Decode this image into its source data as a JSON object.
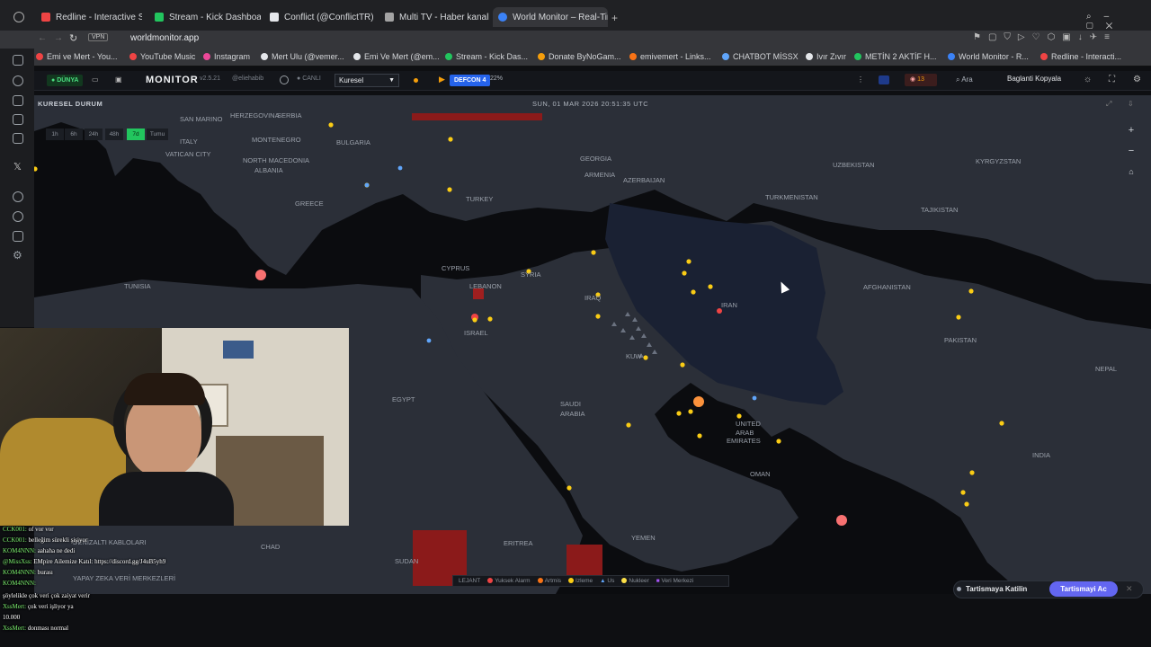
{
  "browser": {
    "tabs": [
      {
        "label": "Redline - Interactive Strate",
        "color": "#ef4444"
      },
      {
        "label": "Stream - Kick Dashboard",
        "color": "#22c55e"
      },
      {
        "label": "Conflict (@ConflictTR) / X",
        "color": "#e5e7eb"
      },
      {
        "label": "Multi TV - Haber kanallar",
        "color": "#a3a3a3"
      },
      {
        "label": "World Monitor – Real-Time",
        "color": "#3b82f6"
      }
    ],
    "vpn_label": "VPN",
    "url": "worldmonitor.app",
    "bookmarks": [
      {
        "label": "Emi ve Mert - You...",
        "color": "#ef4444"
      },
      {
        "label": "YouTube Music",
        "color": "#ef4444"
      },
      {
        "label": "Instagram",
        "color": "#ec4899"
      },
      {
        "label": "Mert Ulu (@vemer...",
        "color": "#e5e7eb"
      },
      {
        "label": "Emi Ve Mert (@em...",
        "color": "#e5e7eb"
      },
      {
        "label": "Stream - Kick Das...",
        "color": "#22c55e"
      },
      {
        "label": "Donate ByNoGam...",
        "color": "#f59e0b"
      },
      {
        "label": "emivemert - Links...",
        "color": "#f97316"
      },
      {
        "label": "CHATBOT MİSSX",
        "color": "#60a5fa"
      },
      {
        "label": "Ivır Zıvır",
        "color": "#e5e7eb"
      },
      {
        "label": "METİN 2 AKTİF H...",
        "color": "#22c55e"
      },
      {
        "label": "World Monitor - R...",
        "color": "#3b82f6"
      },
      {
        "label": "Redline - Interacti...",
        "color": "#ef4444"
      }
    ]
  },
  "app": {
    "live_label": "DÜNYA",
    "title": "MONITOR",
    "version": "v2.5.21",
    "handle": "@eliehabib",
    "live_status": "CANLI",
    "region": "Kuresel",
    "defcon": "DEFCON 4",
    "defcon_pct": "22%",
    "alert_count": "13",
    "search_label": "Ara",
    "copy_link_label": "Baglanti Kopyala"
  },
  "map": {
    "panel_title": "KURESEL DURUM",
    "datetime": "SUN, 01 MAR 2026 20:51:35 UTC",
    "time_ranges": [
      "1h",
      "6h",
      "24h",
      "48h",
      "7d",
      "Tumu"
    ],
    "selected_range": "7d",
    "zoom_in": "+",
    "zoom_out": "−",
    "home": "⌂",
    "labels": [
      {
        "text": "SAN MARINO"
      },
      {
        "text": "HERZEGOVINA"
      },
      {
        "text": "SERBIA"
      },
      {
        "text": "ITALY"
      },
      {
        "text": "MONTENEGRO"
      },
      {
        "text": "BULGARIA"
      },
      {
        "text": "VATICAN CITY"
      },
      {
        "text": "NORTH MACEDONIA"
      },
      {
        "text": "ALBANIA"
      },
      {
        "text": "GREECE"
      },
      {
        "text": "TURKEY"
      },
      {
        "text": "GEORGIA"
      },
      {
        "text": "ARMENIA"
      },
      {
        "text": "AZERBAIJAN"
      },
      {
        "text": "UZBEKISTAN"
      },
      {
        "text": "KYRGYZSTAN"
      },
      {
        "text": "TURKMENISTAN"
      },
      {
        "text": "TAJIKISTAN"
      },
      {
        "text": "TUNISIA"
      },
      {
        "text": "CYPRUS"
      },
      {
        "text": "SYRIA"
      },
      {
        "text": "LEBANON"
      },
      {
        "text": "IRAQ"
      },
      {
        "text": "IRAN"
      },
      {
        "text": "AFGHANISTAN"
      },
      {
        "text": "ISRAEL"
      },
      {
        "text": "KUW"
      },
      {
        "text": "PAKISTAN"
      },
      {
        "text": "NEPAL"
      },
      {
        "text": "EGYPT"
      },
      {
        "text": "SAUDI"
      },
      {
        "text": "ARABIA"
      },
      {
        "text": "UNITED"
      },
      {
        "text": "ARAB"
      },
      {
        "text": "EMIRATES"
      },
      {
        "text": "OMAN"
      },
      {
        "text": "INDIA"
      },
      {
        "text": "CHAD"
      },
      {
        "text": "SUDAN"
      },
      {
        "text": "ERITREA"
      },
      {
        "text": "YEMEN"
      },
      {
        "text": "DENİZALTI KABLOLARI"
      },
      {
        "text": "YAPAY ZEKA VERİ MERKEZLERİ"
      }
    ]
  },
  "legend": {
    "title": "LEJANT",
    "items": [
      {
        "label": "Yuksek Alarm",
        "color": "#ef4444"
      },
      {
        "label": "Artmis",
        "color": "#f97316"
      },
      {
        "label": "Izleme",
        "color": "#facc15"
      },
      {
        "label": "Us",
        "color": "#60a5fa"
      },
      {
        "label": "Nukleer",
        "color": "#fde047"
      },
      {
        "label": "Veri Merkezi",
        "color": "#a855f7"
      }
    ]
  },
  "discussion": {
    "label": "Tartismaya Katilin",
    "button": "Tartismayi Ac"
  },
  "chat": [
    {
      "user": "CCK001:",
      "text": "of vor vor"
    },
    {
      "user": "CCK001:",
      "text": "belleğim sürekli şişiyor"
    },
    {
      "user": "KOM4NNN:",
      "text": "aahaha ne dedi"
    },
    {
      "user": "@MissXss:",
      "text": "EMpire Ailemize Katıl: https://discord.gg/J4uB5yh9"
    },
    {
      "user": "KOM4NNN:",
      "text": "burası"
    },
    {
      "user": "KOM4NNN:",
      "text": ""
    },
    {
      "user": "",
      "text": "şöylelikle çok veri çok zaiyat verir"
    },
    {
      "user": "XssMert:",
      "text": "çok veri işliyor ya"
    },
    {
      "user": "",
      "text": "10.000"
    },
    {
      "user": "XssMert:",
      "text": "donması normal"
    }
  ],
  "colors": {
    "land": "#2b2f38",
    "sea": "#0b0c0f",
    "iran": "#1a2133",
    "hotspot": "#8b1a1a"
  }
}
